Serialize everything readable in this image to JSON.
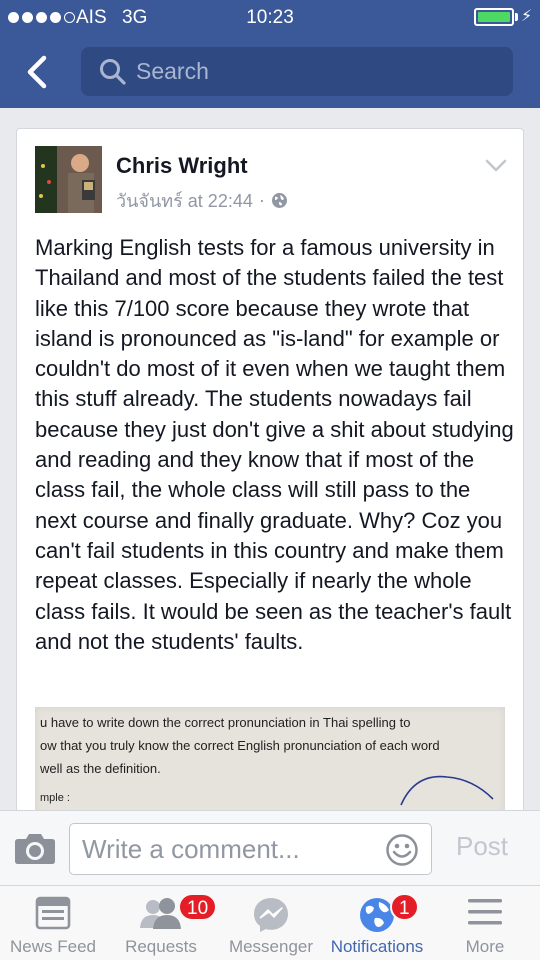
{
  "status_bar": {
    "carrier": "AIS",
    "network": "3G",
    "time": "10:23",
    "signal_bars_filled": 4,
    "signal_bars_total": 5,
    "battery_level": 1.0
  },
  "header": {
    "back_icon": "chevron-left-icon",
    "search_placeholder": "Search"
  },
  "post": {
    "author": "Chris Wright",
    "timestamp": "วันจันทร์ at 22:44",
    "separator": "·",
    "privacy_icon": "globe-icon",
    "text": "Marking English tests for a famous university in Thailand and most of the students failed the test like this 7/100 score because they wrote that island is pronounced as \"is-land\" for example or couldn't do most of it even when we taught them this stuff already. The students nowadays fail because they just don't give a shit about studying and reading and they know that if most of the class fail, the whole class will still pass to the next course and finally graduate. Why? Coz you can't fail students in this country and make them repeat classes. Especially if nearly the whole class fails. It would be seen as the teacher's fault and not the students' faults.",
    "photo_lines": [
      "u have to write down the correct pronunciation in Thai spelling to",
      "ow that you truly know the correct English pronunciation of each word",
      " well as the definition.",
      "mple :"
    ]
  },
  "comment_bar": {
    "placeholder": "Write a comment...",
    "post_label": "Post"
  },
  "tab_bar": {
    "tabs": [
      {
        "label": "News Feed",
        "icon": "news-feed-icon",
        "badge": null,
        "active": false
      },
      {
        "label": "Requests",
        "icon": "friend-requests-icon",
        "badge": "10",
        "active": false
      },
      {
        "label": "Messenger",
        "icon": "messenger-icon",
        "badge": null,
        "active": false
      },
      {
        "label": "Notifications",
        "icon": "globe-notifications-icon",
        "badge": "1",
        "active": true
      },
      {
        "label": "More",
        "icon": "hamburger-menu-icon",
        "badge": null,
        "active": false
      }
    ]
  },
  "colors": {
    "header_blue": "#3b5998",
    "active_tab": "#4267b2",
    "badge_red": "#e41e26",
    "battery_green": "#4cd964"
  }
}
